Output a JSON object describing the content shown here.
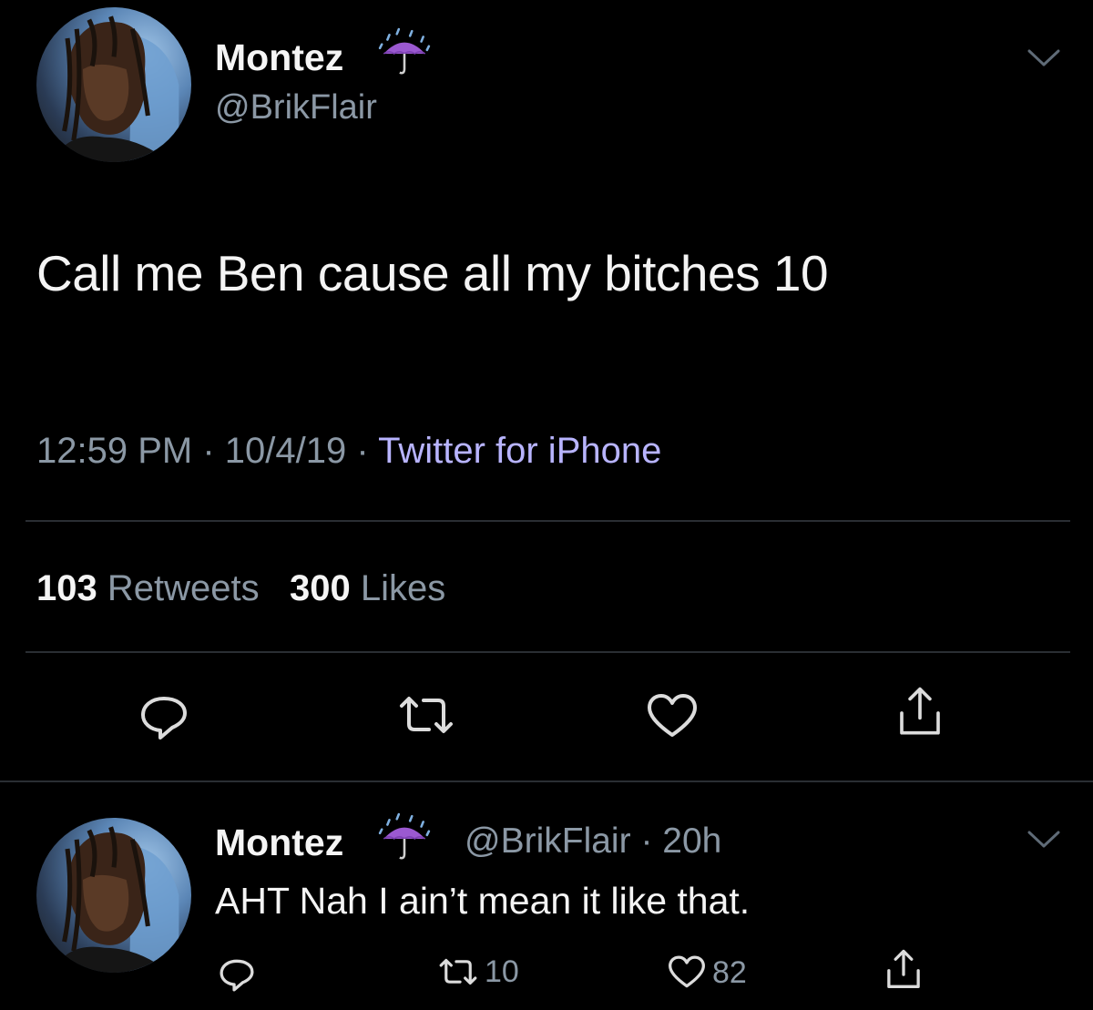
{
  "tweet": {
    "author_name": "Montez",
    "author_handle": "@BrikFlair",
    "author_emoji": "umbrella-with-rain-drops",
    "text": "Call me Ben cause all my bitches 10",
    "time": "12:59 PM",
    "separator": "·",
    "date": "10/4/19",
    "source": "Twitter for iPhone",
    "retweets_count": "103",
    "retweets_label": "Retweets",
    "likes_count": "300",
    "likes_label": "Likes",
    "actions": [
      "reply-icon",
      "retweet-icon",
      "like-icon",
      "share-icon"
    ]
  },
  "reply": {
    "author_name": "Montez",
    "author_emoji": "umbrella-with-rain-drops",
    "handle": "@BrikFlair",
    "separator": "·",
    "time_ago": "20h",
    "text": "AHT Nah I ain’t mean it like that.",
    "retweets": "10",
    "likes": "82"
  },
  "colors": {
    "background": "#000000",
    "text_primary": "#f5f5f5",
    "text_secondary": "#8b98a5",
    "source_link": "#b8b4ff",
    "divider": "#2a2e33",
    "emoji_purple": "#9b59d0"
  }
}
